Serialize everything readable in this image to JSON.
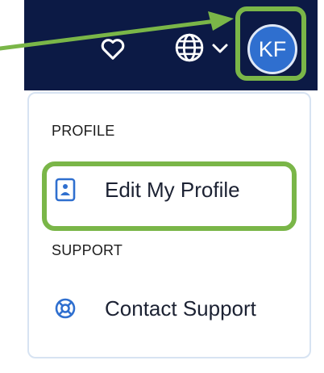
{
  "header": {
    "avatar_initials": "KF",
    "icons": [
      "heart-icon",
      "globe-icon",
      "chevron-down-icon"
    ]
  },
  "menu": {
    "profile_section": "PROFILE",
    "edit_profile": "Edit My Profile",
    "support_section": "SUPPORT",
    "contact_support": "Contact Support"
  },
  "colors": {
    "header_bg": "#0c1a45",
    "avatar_bg": "#2f6fcf",
    "highlight": "#7ab648",
    "accent_icon": "#2f6fcf"
  }
}
